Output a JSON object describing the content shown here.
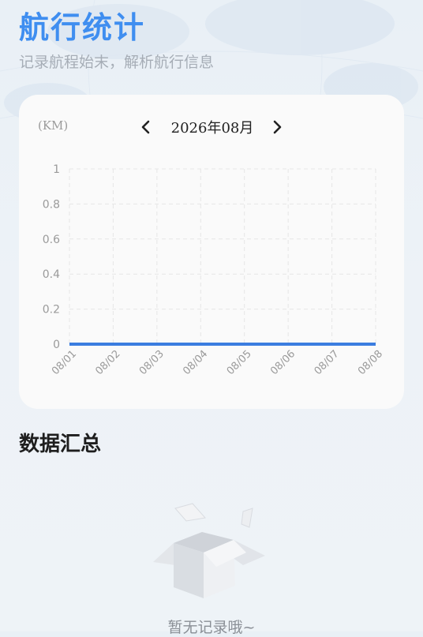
{
  "header": {
    "title": "航行统计",
    "subtitle": "记录航程始末，解析航行信息"
  },
  "chart_card": {
    "unit_label": "(KM)",
    "month_label": "2026年08月",
    "prev_icon": "chevron-left-icon",
    "next_icon": "chevron-right-icon"
  },
  "chart_data": {
    "type": "line",
    "title": "",
    "xlabel": "",
    "ylabel": "(KM)",
    "categories": [
      "08/01",
      "08/02",
      "08/03",
      "08/04",
      "08/05",
      "08/06",
      "08/07",
      "08/08"
    ],
    "series": [
      {
        "values": [
          0,
          0,
          0,
          0,
          0,
          0,
          0,
          0
        ]
      }
    ],
    "ylim": [
      0,
      1
    ],
    "yticks": [
      0,
      0.2,
      0.4,
      0.6,
      0.8,
      1
    ],
    "ytick_labels": [
      "0",
      "0.2",
      "0.4",
      "0.6",
      "0.8",
      "1"
    ],
    "grid": true,
    "line_color": "#3b7de0"
  },
  "summary": {
    "title": "数据汇总",
    "empty_text": "暂无记录哦~",
    "empty_icon": "empty-box-icon"
  }
}
